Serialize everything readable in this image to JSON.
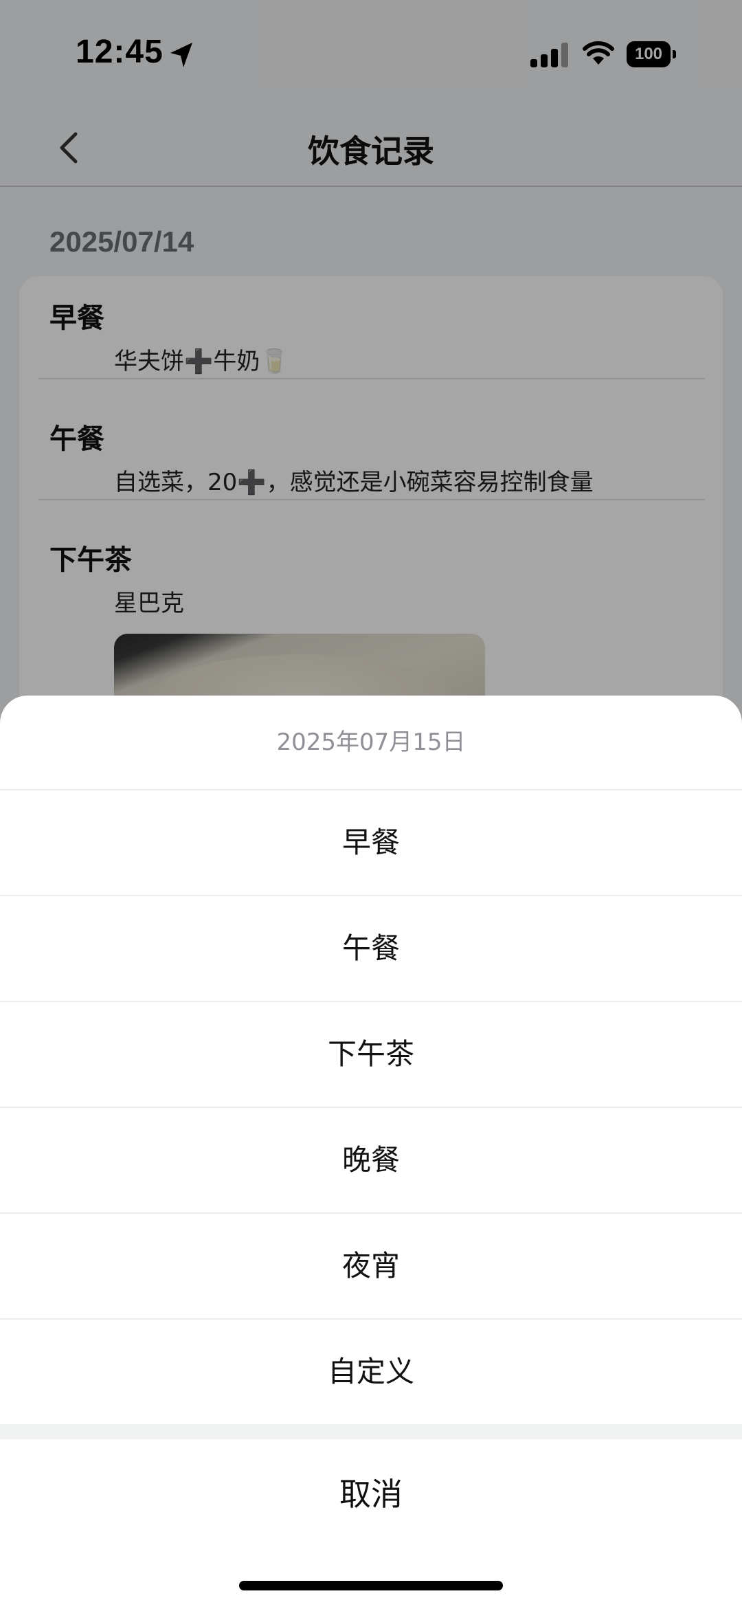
{
  "status_bar": {
    "time": "12:45",
    "battery": "100"
  },
  "nav": {
    "title": "饮食记录"
  },
  "content": {
    "date": "2025/07/14",
    "meals": [
      {
        "title": "早餐",
        "text": "华夫饼➕牛奶🥛"
      },
      {
        "title": "午餐",
        "text": "自选菜，20➕，感觉还是小碗菜容易控制食量"
      },
      {
        "title": "下午茶",
        "text": "星巴克"
      }
    ]
  },
  "action_sheet": {
    "header": "2025年07月15日",
    "options": [
      "早餐",
      "午餐",
      "下午茶",
      "晚餐",
      "夜宵",
      "自定义"
    ],
    "cancel": "取消"
  }
}
